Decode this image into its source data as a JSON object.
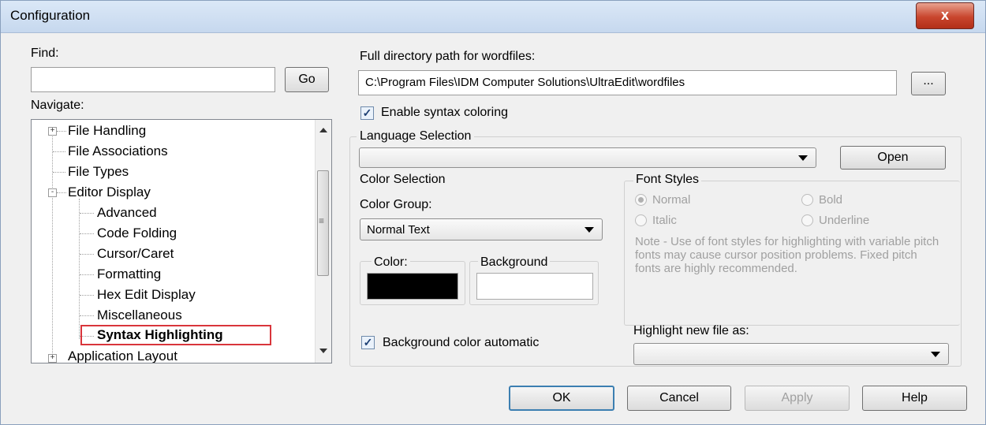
{
  "window": {
    "title": "Configuration",
    "close_label": "x"
  },
  "left": {
    "find_label": "Find:",
    "find_value": "",
    "go_label": "Go",
    "navigate_label": "Navigate:",
    "tree": [
      {
        "label": "File Handling",
        "expander": "+"
      },
      {
        "label": "File Associations"
      },
      {
        "label": "File Types"
      },
      {
        "label": "Editor Display",
        "expander": "-"
      },
      {
        "label": "Advanced"
      },
      {
        "label": "Code Folding"
      },
      {
        "label": "Cursor/Caret"
      },
      {
        "label": "Formatting"
      },
      {
        "label": "Hex Edit Display"
      },
      {
        "label": "Miscellaneous"
      },
      {
        "label": "Syntax Highlighting",
        "selected": true
      },
      {
        "label": "Application Layout",
        "expander": "+"
      }
    ],
    "scroll_grip": "≡"
  },
  "right": {
    "path_label": "Full directory path for wordfiles:",
    "path_value": "C:\\Program Files\\IDM Computer Solutions\\UltraEdit\\wordfiles",
    "browse_label": "...",
    "enable_syntax_label": "Enable syntax coloring",
    "enable_syntax_checked": true,
    "language_selection_title": "Language Selection",
    "language_value": "",
    "open_label": "Open",
    "color_selection_title": "Color Selection",
    "color_group_label": "Color Group:",
    "color_group_value": "Normal Text",
    "color_label": "Color:",
    "background_label": "Background",
    "color_swatch": "#000000",
    "background_swatch": "#ffffff",
    "bg_auto_label": "Background color automatic",
    "bg_auto_checked": true,
    "font_styles_title": "Font Styles",
    "font_styles": {
      "normal": "Normal",
      "bold": "Bold",
      "italic": "Italic",
      "underline": "Underline"
    },
    "note": "Note - Use of font styles for highlighting with variable pitch fonts may cause cursor position problems.  Fixed pitch fonts are highly recommended.",
    "highlight_label": "Highlight new file as:",
    "highlight_value": ""
  },
  "buttons": {
    "ok": "OK",
    "cancel": "Cancel",
    "apply": "Apply",
    "help": "Help"
  },
  "colors": {
    "selection_border": "#d9353b"
  }
}
